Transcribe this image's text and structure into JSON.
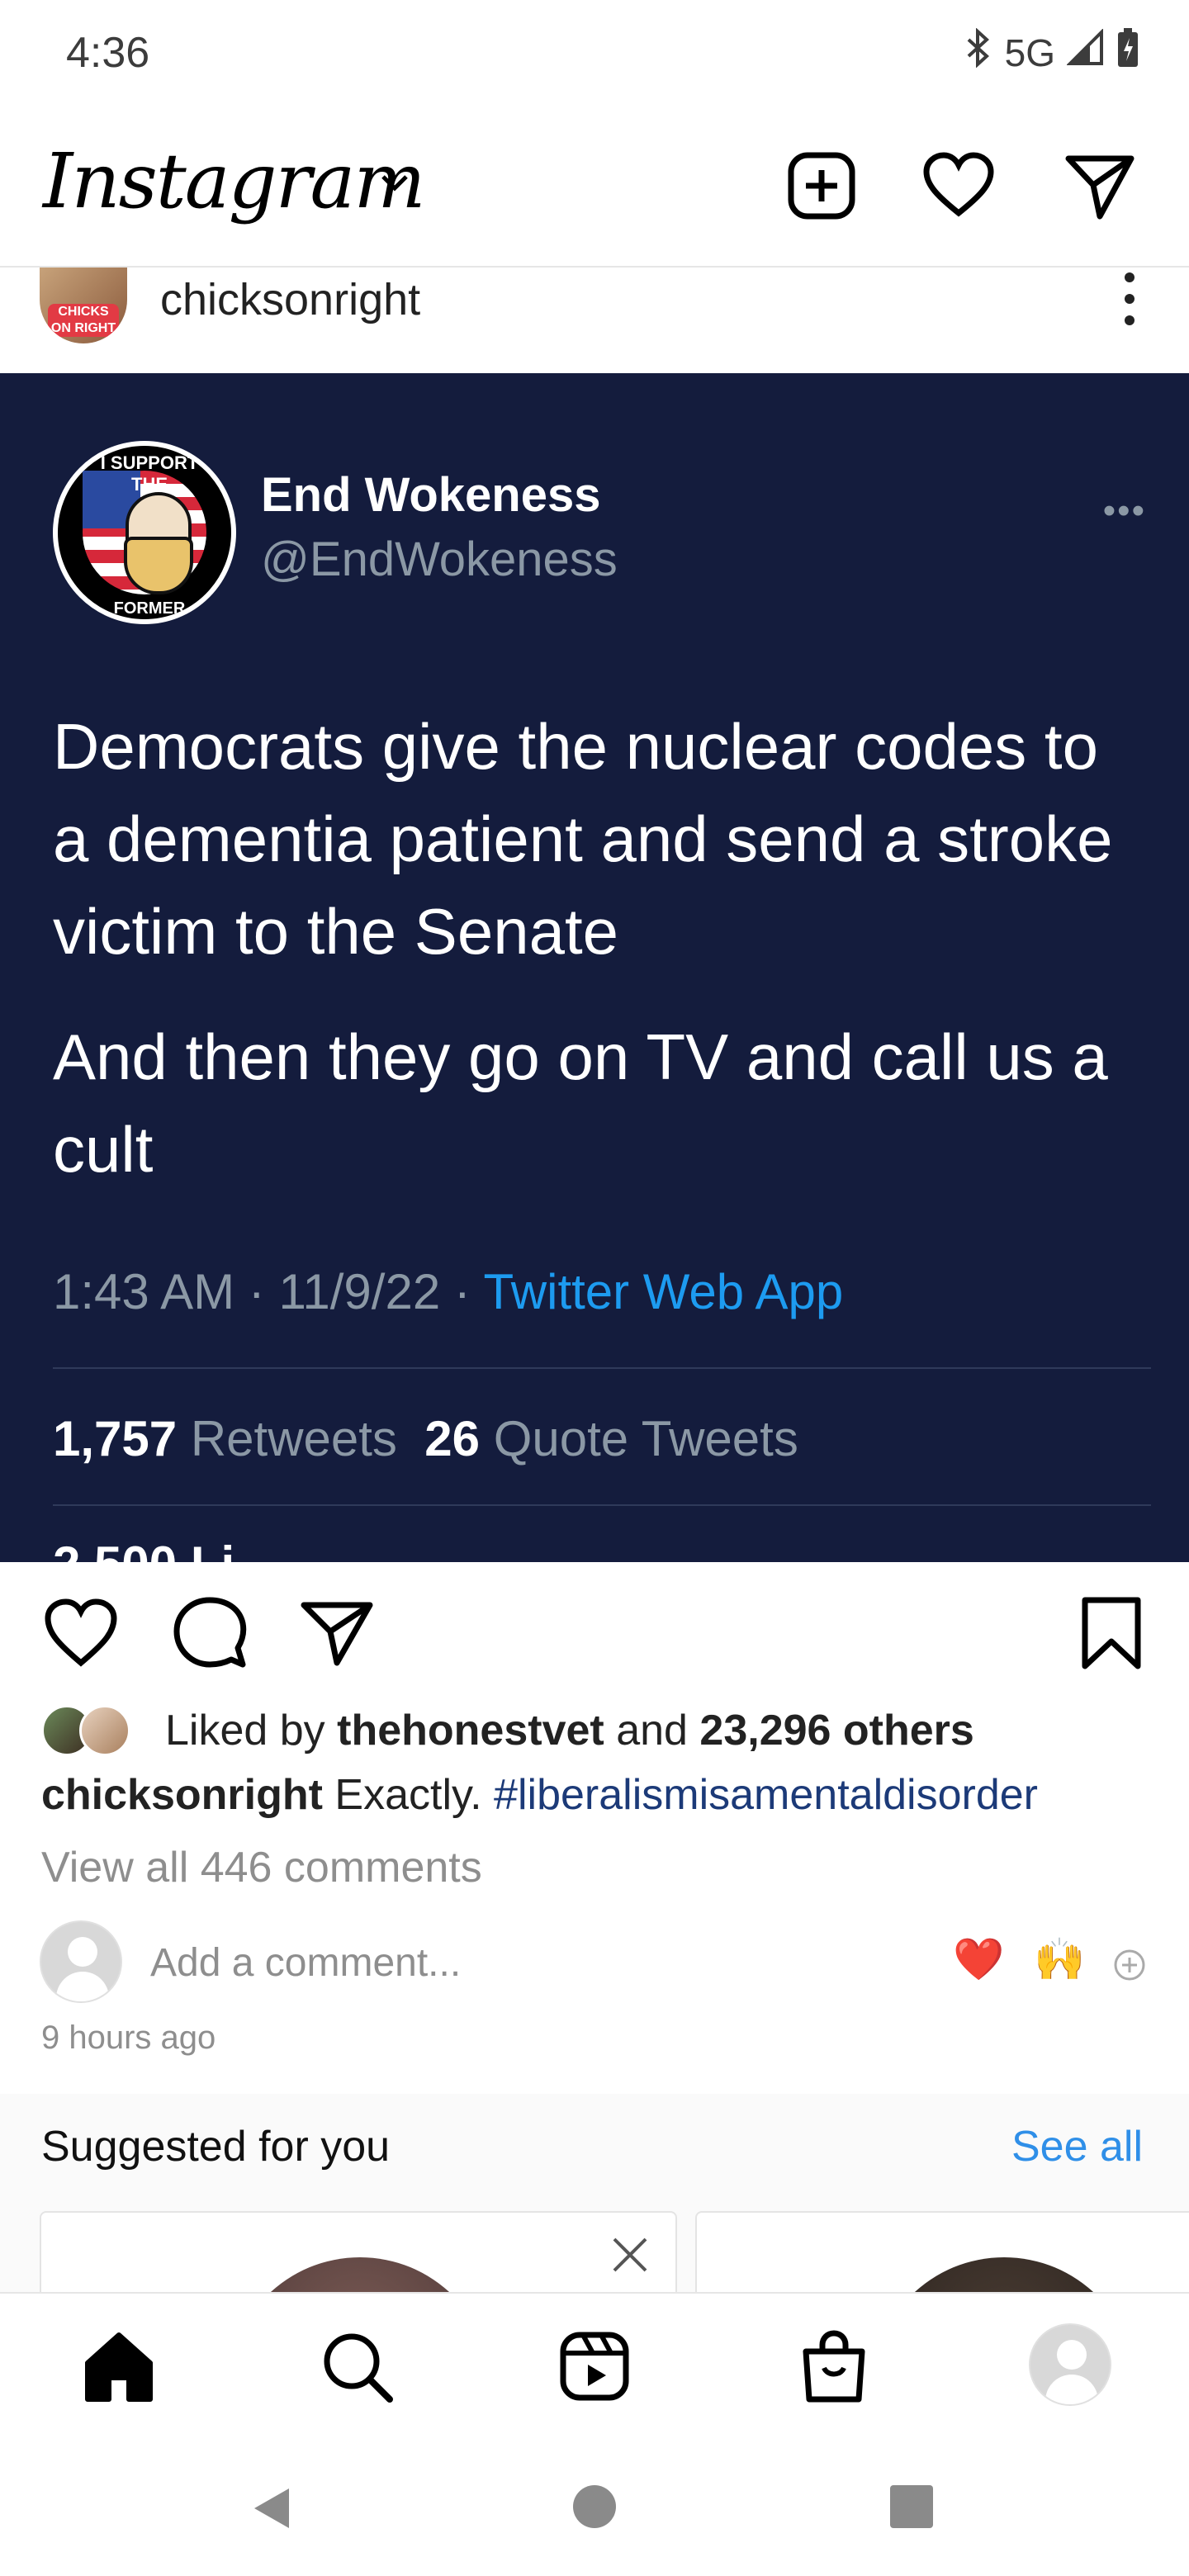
{
  "status_bar": {
    "time": "4:36",
    "network": "5G"
  },
  "header": {
    "app_name": "Instagram"
  },
  "post": {
    "author": "chicksonright",
    "author_avatar_badge": "CHICKS ON RIGHT",
    "tweet": {
      "display_name": "End Wokeness",
      "handle": "@EndWokeness",
      "avatar_text_top": "I SUPPORT THE",
      "avatar_text_bottom": "FORMER THINGS",
      "paragraph_1": "Democrats give the nuclear codes to a dementia patient and send a stroke victim to the Senate",
      "paragraph_2": "And then they go on TV and call us a cult",
      "time": "1:43 AM · 11/9/22 · ",
      "app": "Twitter Web App",
      "retweets_count": "1,757",
      "retweets_label": "Retweets",
      "quotes_count": "26",
      "quotes_label": "Quote Tweets",
      "likes_cut": "2,500 Li"
    },
    "likes": {
      "prefix": "Liked by ",
      "user": "thehonestvet",
      "middle": " and ",
      "others": "23,296 others"
    },
    "caption": {
      "user": "chicksonright",
      "text": " Exactly. ",
      "hashtag": "#liberalismisamentaldisorder"
    },
    "view_comments": "View all 446 comments",
    "comment_placeholder": "Add a comment...",
    "quick_emojis": [
      "❤️",
      "🙌"
    ],
    "time_ago": "9 hours ago"
  },
  "suggested": {
    "title": "Suggested for you",
    "see_all": "See all"
  },
  "bottom_nav": [
    "home-icon",
    "search-icon",
    "reels-icon",
    "shop-icon",
    "profile-avatar"
  ]
}
